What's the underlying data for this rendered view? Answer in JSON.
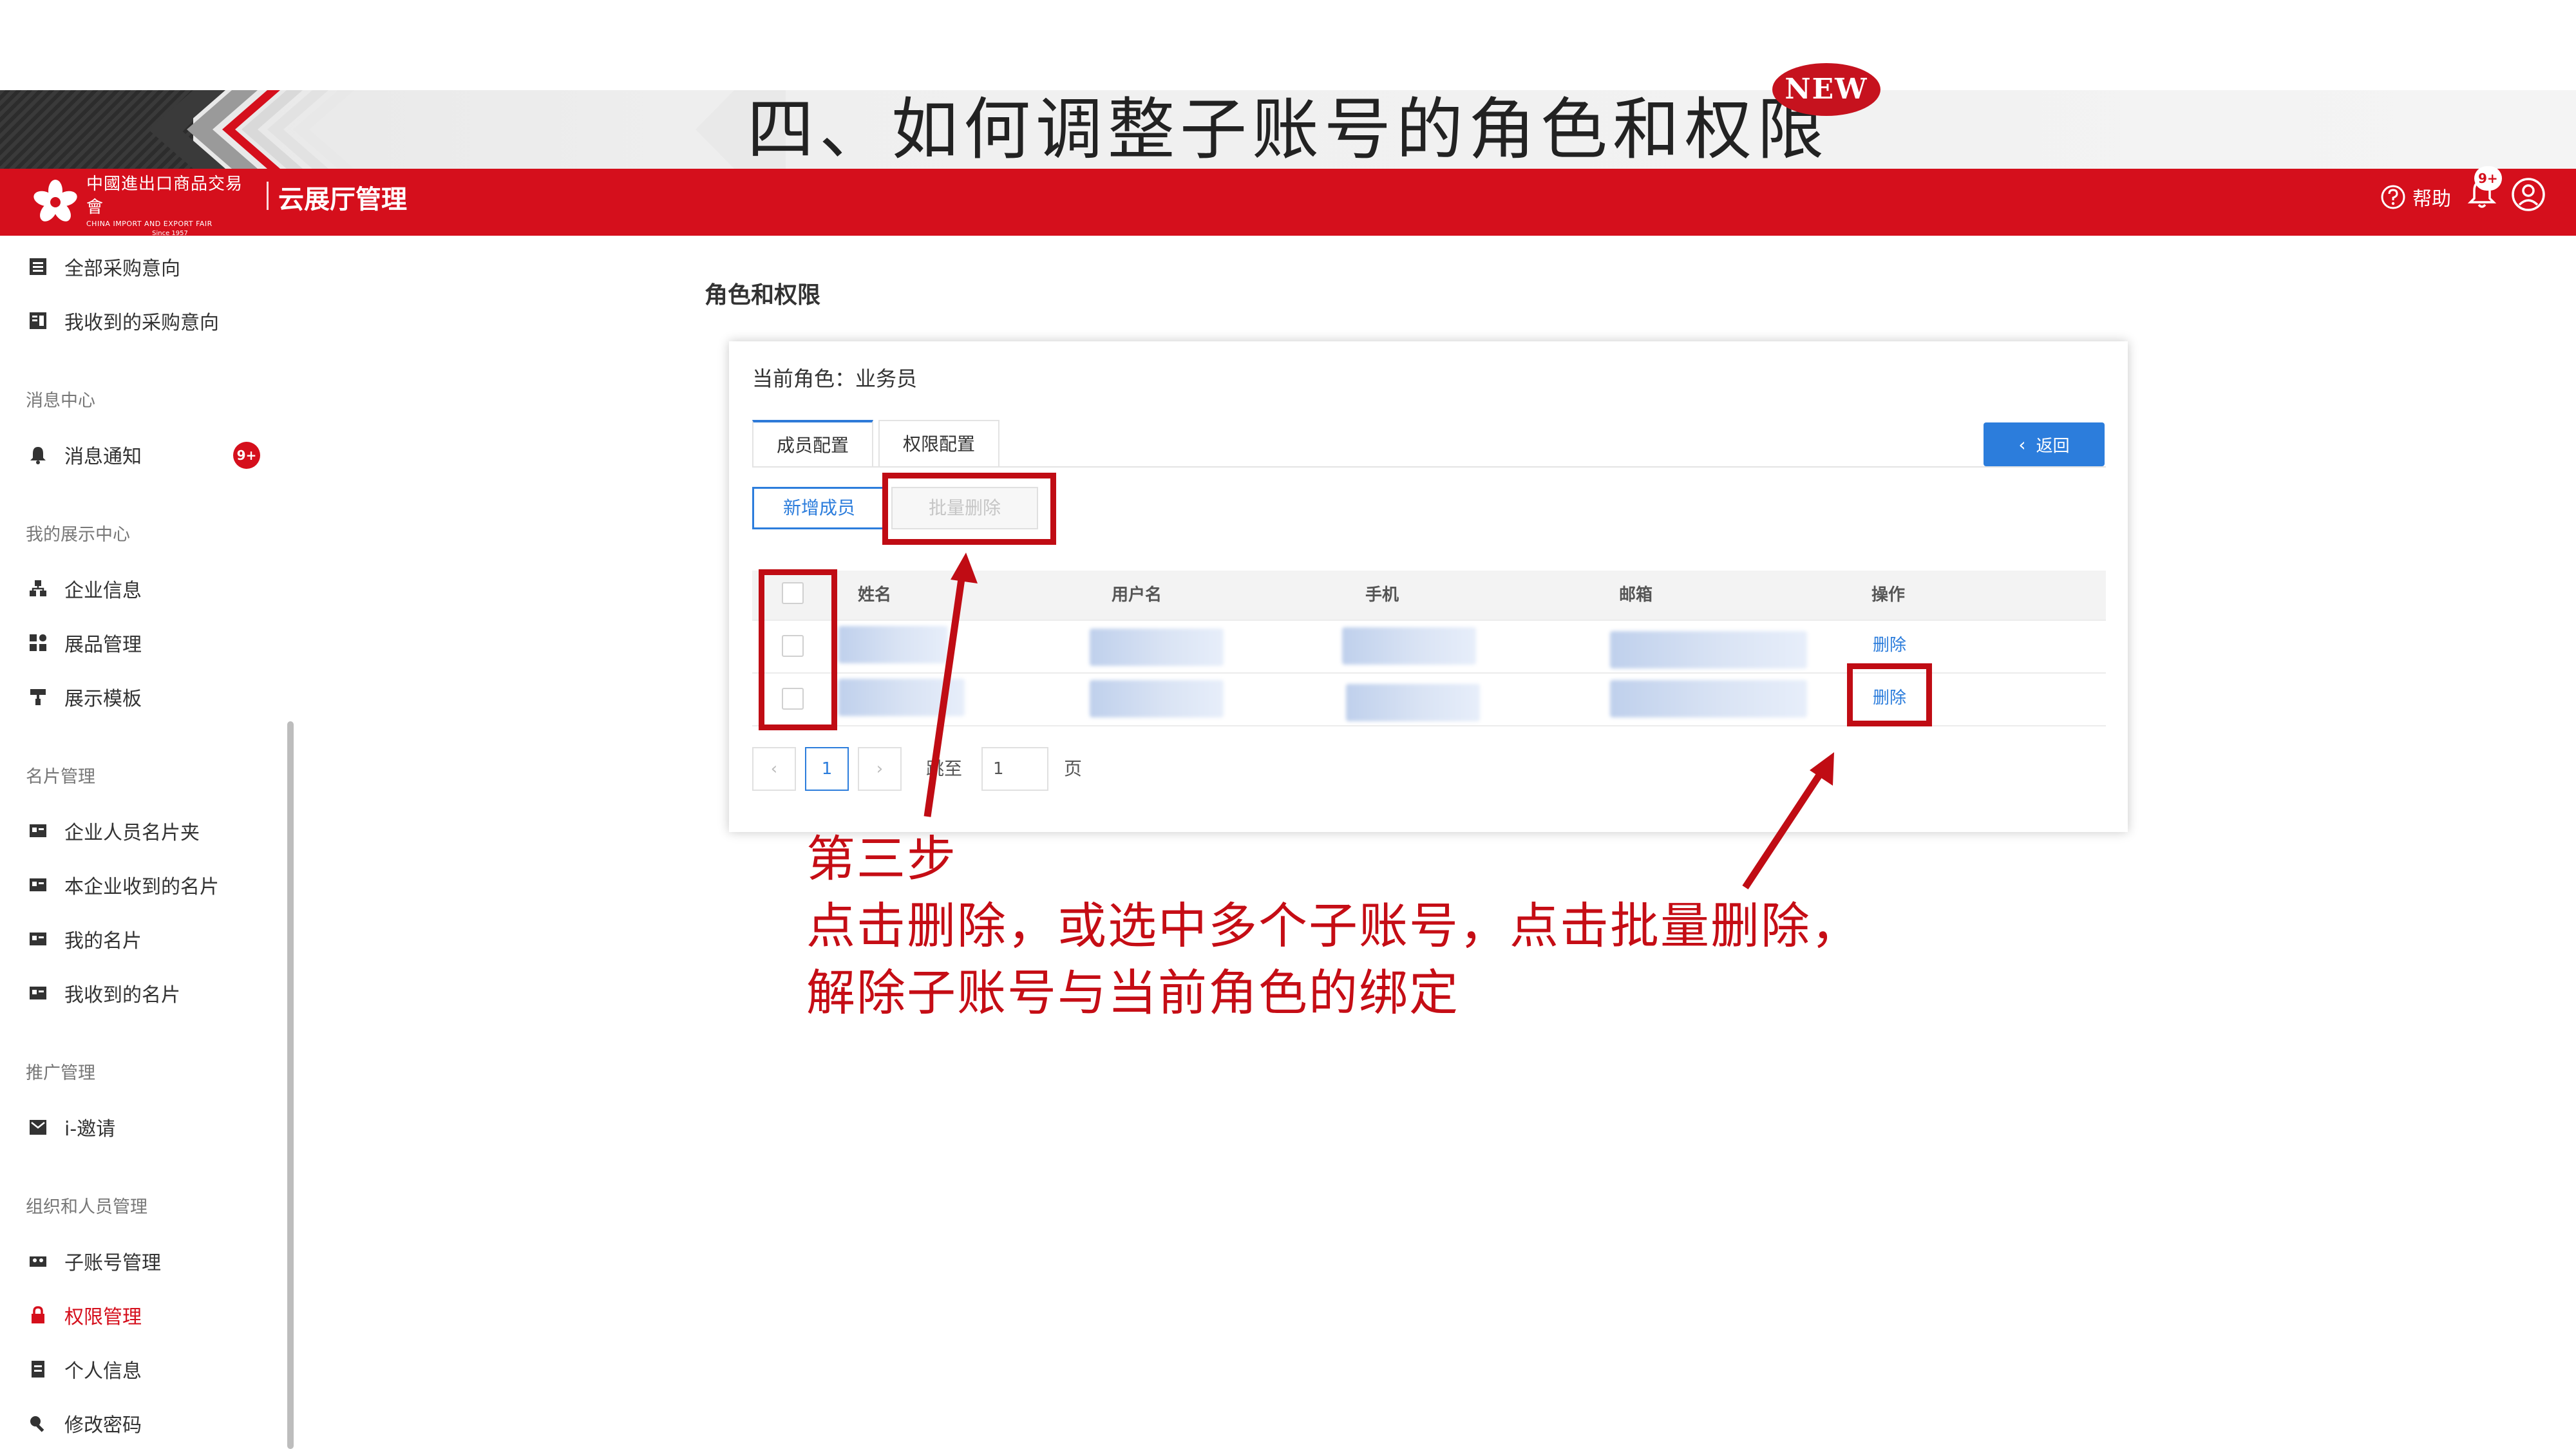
{
  "slide": {
    "title": "四、如何调整子账号的角色和权限",
    "new_badge": "NEW"
  },
  "header": {
    "logo_cn": "中國進出口商品交易會",
    "logo_en": "CHINA IMPORT AND EXPORT FAIR",
    "logo_since": "Since 1957",
    "app_name": "云展厅管理",
    "help_label": "帮助",
    "bell_badge": "9+",
    "colors": {
      "brand_red": "#d50f1c",
      "accent_blue": "#2c7ddc"
    }
  },
  "sidebar": {
    "items_top": [
      {
        "label": "全部采购意向",
        "icon": "list-icon"
      },
      {
        "label": "我收到的采购意向",
        "icon": "inbox-list-icon"
      }
    ],
    "groups": [
      {
        "title": "消息中心",
        "items": [
          {
            "label": "消息通知",
            "icon": "bell-icon",
            "badge": "9+"
          }
        ]
      },
      {
        "title": "我的展示中心",
        "items": [
          {
            "label": "企业信息",
            "icon": "org-icon"
          },
          {
            "label": "展品管理",
            "icon": "grid-icon"
          },
          {
            "label": "展示模板",
            "icon": "brush-icon"
          }
        ]
      },
      {
        "title": "名片管理",
        "items": [
          {
            "label": "企业人员名片夹",
            "icon": "card-icon"
          },
          {
            "label": "本企业收到的名片",
            "icon": "card-icon"
          },
          {
            "label": "我的名片",
            "icon": "card-icon"
          },
          {
            "label": "我收到的名片",
            "icon": "card-icon"
          }
        ]
      },
      {
        "title": "推广管理",
        "items": [
          {
            "label": "i-邀请",
            "icon": "mail-icon"
          }
        ]
      },
      {
        "title": "组织和人员管理",
        "items": [
          {
            "label": "子账号管理",
            "icon": "users-icon"
          },
          {
            "label": "权限管理",
            "icon": "lock-icon",
            "active": true
          },
          {
            "label": "个人信息",
            "icon": "doc-icon"
          },
          {
            "label": "修改密码",
            "icon": "key-icon"
          }
        ]
      }
    ]
  },
  "content": {
    "page_title": "角色和权限",
    "current_role": "当前角色：业务员",
    "tabs": [
      {
        "label": "成员配置",
        "active": true
      },
      {
        "label": "权限配置",
        "active": false
      }
    ],
    "back_label": "返回",
    "add_member_label": "新增成员",
    "bulk_delete_label": "批量删除",
    "table": {
      "columns": [
        "姓名",
        "用户名",
        "手机",
        "邮箱",
        "操作"
      ],
      "rows": [
        {
          "action": "删除"
        },
        {
          "action": "删除"
        }
      ]
    },
    "pager": {
      "prev": "‹",
      "current": "1",
      "next": "›",
      "goto_label": "跳至",
      "goto_value": "1",
      "page_suffix": "页"
    }
  },
  "annotation": {
    "step": "第三步",
    "line1": "点击删除，或选中多个子账号，点击批量删除，",
    "line2": "解除子账号与当前角色的绑定",
    "color": "#c50d15"
  }
}
